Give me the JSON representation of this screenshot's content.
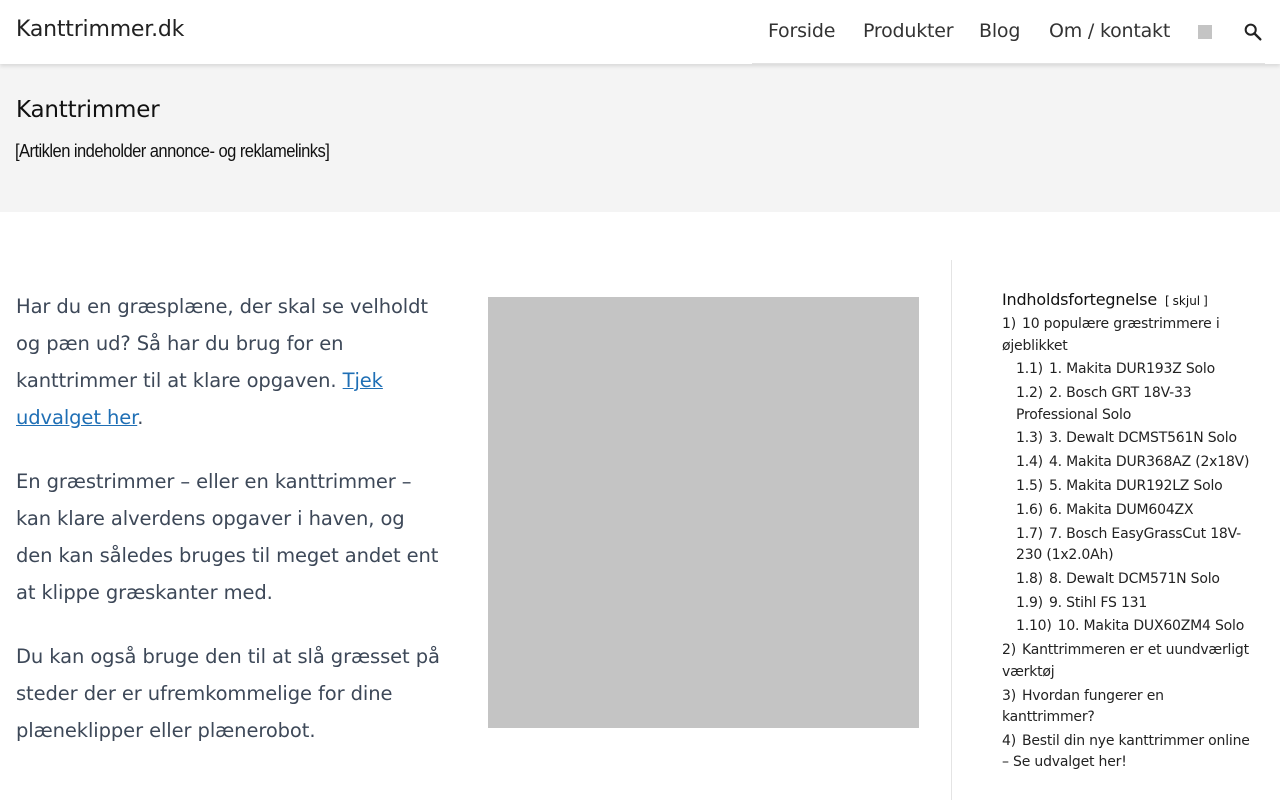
{
  "header": {
    "brand": "Kanttrimmer.dk",
    "nav": [
      "Forside",
      "Produkter",
      "Blog",
      "Om / kontakt"
    ],
    "icons": [
      "image-placeholder-icon",
      "search-icon"
    ]
  },
  "hero": {
    "title": "Kanttrimmer",
    "disclaimer": "[Artiklen indeholder annonce- og reklamelinks]"
  },
  "content": {
    "p1_text": "Har du en græsplæne, der skal se velholdt og pæn ud? Så har du brug for en kanttrimmer til at klare opgaven. ",
    "p1_link": "Tjek udvalget her",
    "p1_end": ".",
    "p2": "En græstrimmer – eller en kanttrimmer – kan klare alverdens opgaver i haven, og den kan således bruges til meget andet ent at klippe græskanter med.",
    "p3": "Du kan også bruge den til at slå græsset på steder der er ufremkommelige for dine plæneklipper eller plænerobot."
  },
  "toc": {
    "title": "Indholdsfortegnelse",
    "toggle_open": "[",
    "toggle_label": "skjul",
    "toggle_close": "]",
    "items": [
      {
        "num": "1)",
        "text": "10 populære græstrimmere i øjeblikket",
        "level": 1
      },
      {
        "num": "1.1)",
        "text": "1. Makita DUR193Z Solo",
        "level": 2
      },
      {
        "num": "1.2)",
        "text": "2. Bosch GRT 18V-33 Professional Solo",
        "level": 2
      },
      {
        "num": "1.3)",
        "text": "3. Dewalt DCMST561N Solo",
        "level": 2
      },
      {
        "num": "1.4)",
        "text": "4. Makita DUR368AZ (2x18V)",
        "level": 2
      },
      {
        "num": "1.5)",
        "text": "5. Makita DUR192LZ Solo",
        "level": 2
      },
      {
        "num": "1.6)",
        "text": "6. Makita DUM604ZX",
        "level": 2
      },
      {
        "num": "1.7)",
        "text": "7. Bosch EasyGrassCut 18V-230 (1x2.0Ah)",
        "level": 2
      },
      {
        "num": "1.8)",
        "text": "8. Dewalt DCM571N Solo",
        "level": 2
      },
      {
        "num": "1.9)",
        "text": "9. Stihl FS 131",
        "level": 2
      },
      {
        "num": "1.10)",
        "text": "10. Makita DUX60ZM4 Solo",
        "level": 2
      },
      {
        "num": "2)",
        "text": "Kanttrimmeren er et uundværligt værktøj",
        "level": 1
      },
      {
        "num": "3)",
        "text": "Hvordan fungerer en kanttrimmer?",
        "level": 1
      },
      {
        "num": "4)",
        "text": "Bestil din nye kanttrimmer online – Se udvalget her!",
        "level": 1
      }
    ]
  },
  "colors": {
    "link": "#1f6fb5",
    "hero_bg": "#f4f4f4",
    "placeholder": "#c4c4c4"
  }
}
